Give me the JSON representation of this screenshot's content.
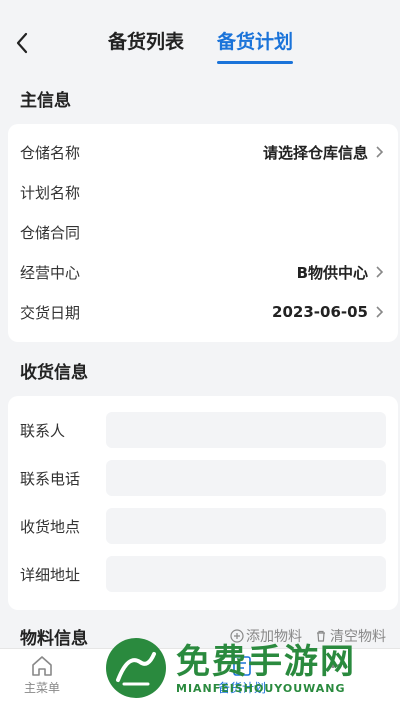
{
  "header": {
    "tabs": [
      {
        "label": "备货列表",
        "active": false
      },
      {
        "label": "备货计划",
        "active": true
      }
    ],
    "accent_color": "#1a73d9"
  },
  "main_info": {
    "title": "主信息",
    "rows": [
      {
        "label": "仓储名称",
        "value": "请选择仓库信息",
        "has_chevron": true
      },
      {
        "label": "计划名称",
        "value": "",
        "has_chevron": false
      },
      {
        "label": "仓储合同",
        "value": "",
        "has_chevron": false
      },
      {
        "label": "经营中心",
        "value": "B物供中心",
        "has_chevron": true
      },
      {
        "label": "交货日期",
        "value": "2023-06-05",
        "has_chevron": true
      }
    ]
  },
  "receive_info": {
    "title": "收货信息",
    "fields": [
      {
        "label": "联系人",
        "value": ""
      },
      {
        "label": "联系电话",
        "value": ""
      },
      {
        "label": "收货地点",
        "value": ""
      },
      {
        "label": "详细地址",
        "value": ""
      }
    ]
  },
  "material_info": {
    "title": "物料信息",
    "add_label": "添加物料",
    "clear_label": "清空物料"
  },
  "bottom_nav": {
    "items": [
      {
        "label": "主菜单",
        "icon": "home-icon"
      },
      {
        "label": "",
        "icon": "list-icon"
      },
      {
        "label": "备货计划",
        "icon": "plan-icon"
      },
      {
        "label": "",
        "icon": "more-icon"
      }
    ]
  },
  "watermark": {
    "title": "免费手游网",
    "subtitle": "MIANFEISHOUYOUWANG"
  }
}
